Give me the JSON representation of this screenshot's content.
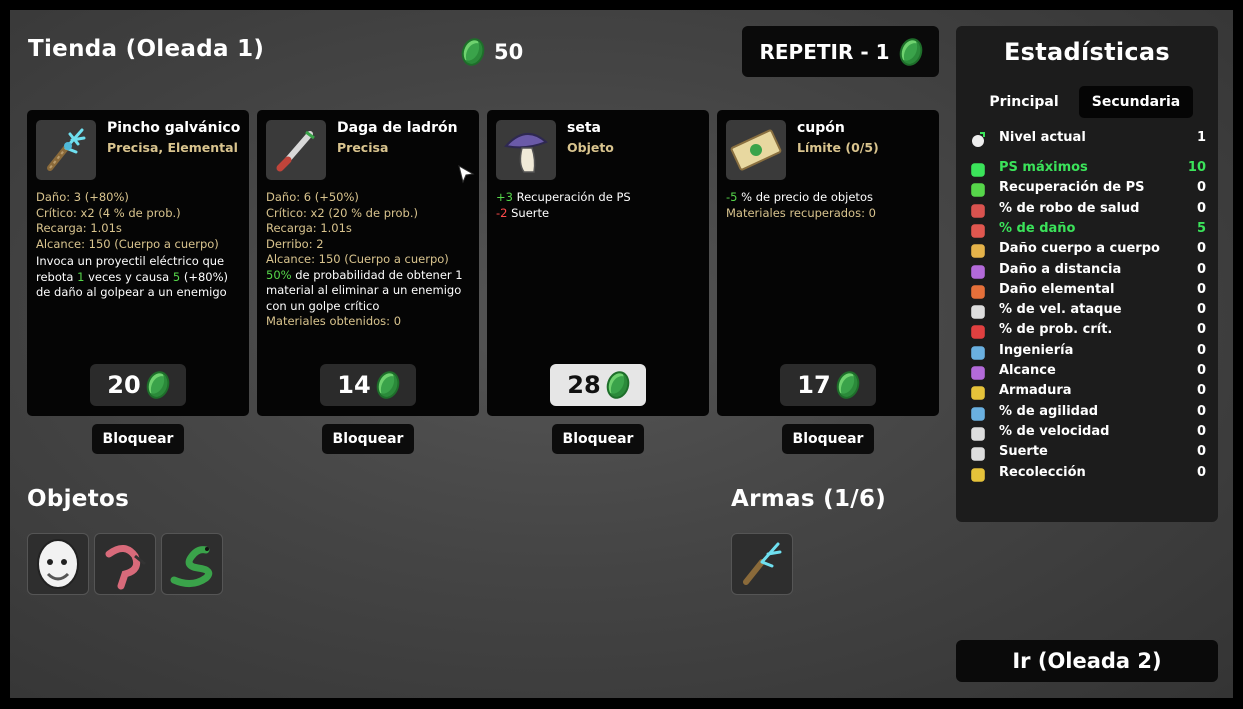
{
  "header": {
    "shop_title": "Tienda (Oleada 1)",
    "currency": "50",
    "reroll_label": "REPETIR - 1"
  },
  "cards": [
    {
      "name": "Pincho galvánico",
      "type": "Precisa, Elemental",
      "lines": [
        "Daño: 3 (+80%)",
        "Crítico: x2 (4 % de prob.)",
        "Recarga: 1.01s",
        "Alcance: 150 (Cuerpo a cuerpo)"
      ],
      "effect_parts": [
        "Invoca un proyectil eléctrico que rebota ",
        "1",
        " veces y causa ",
        "5",
        " (+80%",
        ") de daño al golpear a un enemigo"
      ],
      "price": "20",
      "lock_label": "Bloquear"
    },
    {
      "name": "Daga de ladrón",
      "type": "Precisa",
      "lines": [
        "Daño: 6 (+50%)",
        "Crítico: x2 (20 % de prob.)",
        "Recarga: 1.01s",
        "Derribo: 2",
        "Alcance: 150 (Cuerpo a cuerpo)"
      ],
      "effect_parts": [
        "50%",
        " de probabilidad de obtener 1 material al eliminar a un enemigo con un golpe crítico"
      ],
      "extra_line": "Materiales obtenidos: 0",
      "price": "14",
      "lock_label": "Bloquear"
    },
    {
      "name": "seta",
      "type": "Objeto",
      "stat_lines": [
        {
          "value": "+3",
          "text": " Recuperación de PS",
          "positive": true
        },
        {
          "value": "-2",
          "text": " Suerte",
          "positive": false
        }
      ],
      "price": "28",
      "lock_label": "Bloquear"
    },
    {
      "name": "cupón",
      "type": "Límite (0/5)",
      "stat_lines": [
        {
          "value": "-5",
          "text": " % de precio de objetos",
          "positive": true
        }
      ],
      "extra_line": "Materiales recuperados: 0",
      "price": "17",
      "lock_label": "Bloquear"
    }
  ],
  "inventory": {
    "items_title": "Objetos",
    "items": [
      "egg-face-icon",
      "flamingo-icon",
      "snake-icon"
    ],
    "weapons_title": "Armas (1/6)",
    "weapons": [
      "galvanic-spike-icon"
    ]
  },
  "stats_panel": {
    "title": "Estadísticas",
    "tabs": [
      "Principal",
      "Secundaria"
    ],
    "active_tab": "Secundaria",
    "level": {
      "label": "Nivel actual",
      "value": "1"
    },
    "rows": [
      {
        "label": "PS máximos",
        "value": "10",
        "highlight": true,
        "icon": "heart-icon",
        "color": "#3be35a"
      },
      {
        "label": "Recuperación de PS",
        "value": "0",
        "icon": "heal-icon",
        "color": "#56d64a"
      },
      {
        "label": "% de robo de salud",
        "value": "0",
        "icon": "fangs-icon",
        "color": "#d9534f"
      },
      {
        "label": "% de daño",
        "value": "5",
        "highlight": true,
        "icon": "muscle-icon",
        "color": "#e0574f"
      },
      {
        "label": "Daño cuerpo a cuerpo",
        "value": "0",
        "icon": "sword-icon",
        "color": "#e5b34a"
      },
      {
        "label": "Daño a distancia",
        "value": "0",
        "icon": "bow-icon",
        "color": "#b36ad9"
      },
      {
        "label": "Daño elemental",
        "value": "0",
        "icon": "flame-icon",
        "color": "#e5703a"
      },
      {
        "label": "% de vel. ataque",
        "value": "0",
        "icon": "hourglass-icon",
        "color": "#dddddd"
      },
      {
        "label": "% de prob. crít.",
        "value": "0",
        "icon": "crit-icon",
        "color": "#e04040"
      },
      {
        "label": "Ingeniería",
        "value": "0",
        "icon": "wrench-icon",
        "color": "#6ab0e0"
      },
      {
        "label": "Alcance",
        "value": "0",
        "icon": "range-icon",
        "color": "#b36ad9"
      },
      {
        "label": "Armadura",
        "value": "0",
        "icon": "shield-icon",
        "color": "#e5c23a"
      },
      {
        "label": "% de agilidad",
        "value": "0",
        "icon": "dodge-icon",
        "color": "#6ab0e0"
      },
      {
        "label": "% de velocidad",
        "value": "0",
        "icon": "boot-icon",
        "color": "#dddddd"
      },
      {
        "label": "Suerte",
        "value": "0",
        "icon": "dice-icon",
        "color": "#dddddd"
      },
      {
        "label": "Recolección",
        "value": "0",
        "icon": "harvest-icon",
        "color": "#e5c23a"
      }
    ]
  },
  "next_wave_label": "Ir (Oleada 2)"
}
